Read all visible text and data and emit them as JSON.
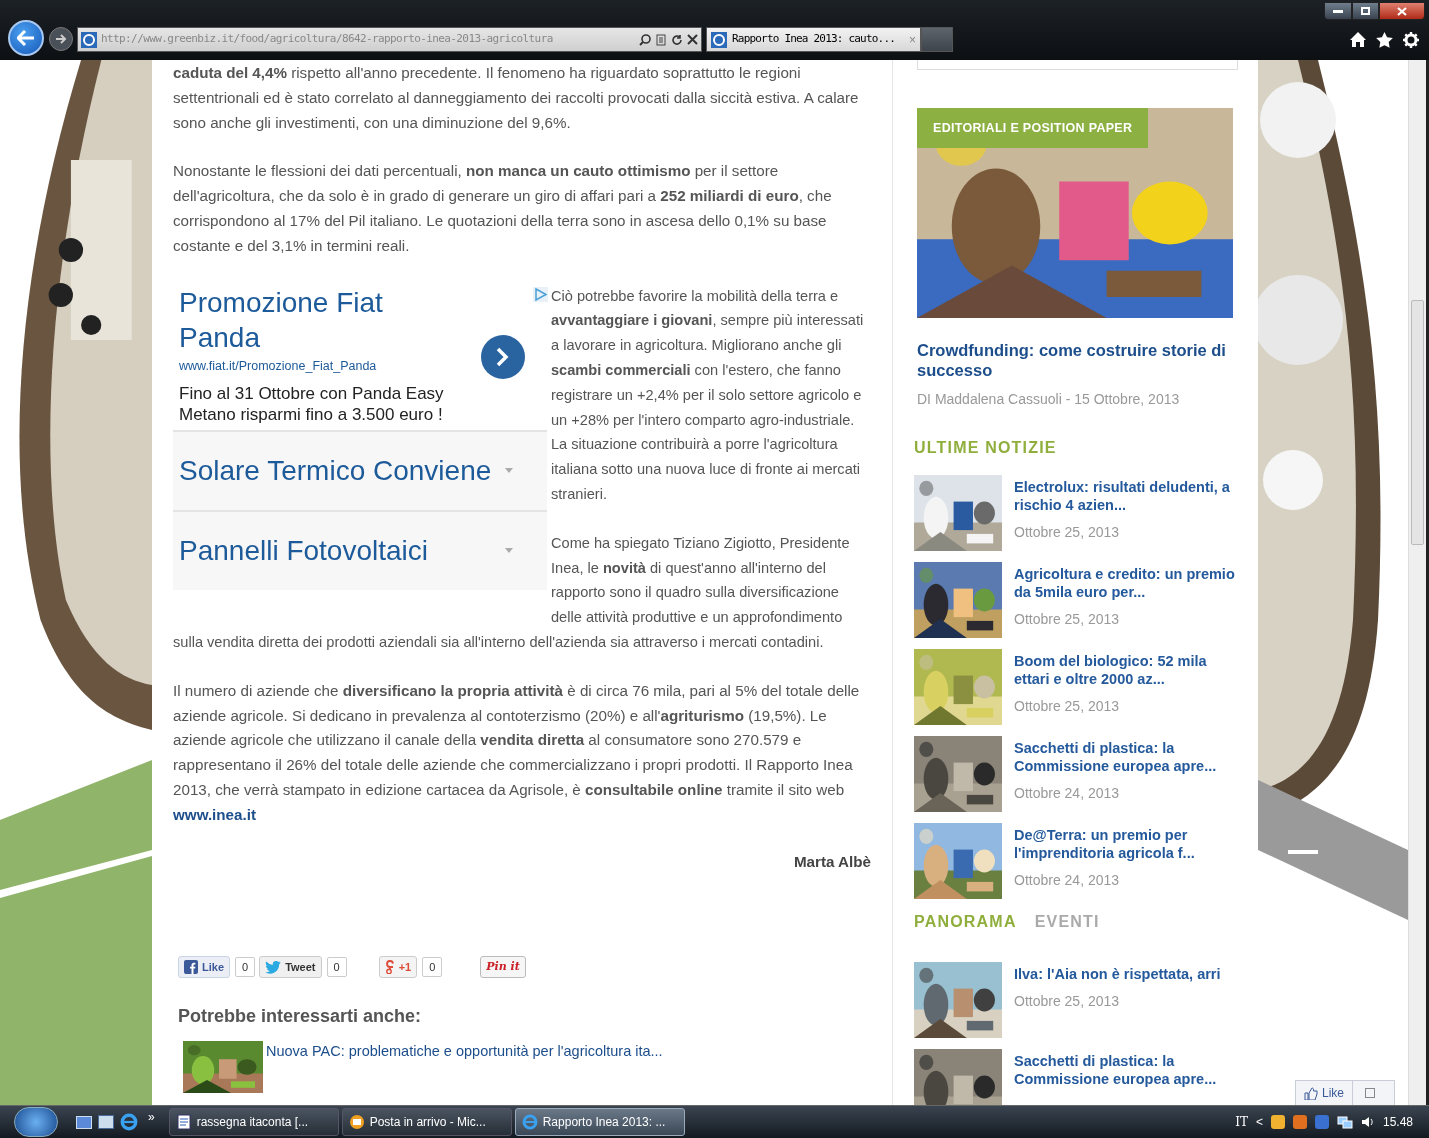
{
  "browser": {
    "url": "http://www.greenbiz.it/food/agricoltura/8642-rapporto-inea-2013-agricoltura",
    "tabs": [
      {
        "title": "Rapporto Inea 2013: cauto...",
        "close": "×",
        "selected": true
      }
    ]
  },
  "article": {
    "paragraphs_top": [
      "**caduta del 4,4%** rispetto all'anno precedente. Il fenomeno ha riguardato soprattutto le regioni settentrionali ed è stato correlato al danneggiamento dei raccolti provocati dalla siccità estiva. A calare sono anche gli investimenti, con una diminuzione del 9,6%.",
      "Nonostante le flessioni dei dati percentuali, **non manca un cauto ottimismo** per il settore dell'agricoltura, che da solo è in grado di generare un giro di affari pari a **252 miliardi di euro**, che corrispondono al 17% del Pil italiano. Le quotazioni della terra sono in ascesa dello 0,1% su base costante e del 3,1% in termini reali."
    ],
    "ad": {
      "title": "Promozione Fiat Panda",
      "url": "www.fiat.it/Promozione_Fiat_Panda",
      "text": "Fino al 31 Ottobre con Panda Easy Metano risparmi fino a 3.500 euro !",
      "links": [
        {
          "title": "Solare Termico Conviene",
          "expanded": false
        },
        {
          "title": "Pannelli Fotovoltaici",
          "expanded": false
        }
      ]
    },
    "paragraphs_wrap": [
      "Ciò potrebbe favorire la mobilità della terra e **avvantaggiare i giovani**, sempre  più interessati a lavorare in agricoltura. Migliorano anche gli **scambi commerciali** con l'estero, che fanno registrare un +2,4% per il solo settore agricolo e un +28% per l'intero comparto agro-industriale. La situazione contribuirà a porre l'agricoltura italiana sotto una nuova luce di fronte ai mercati stranieri.",
      "Come ha spiegato Tiziano Zigiotto, Presidente Inea, le **novità** di quest'anno all'interno del rapporto sono il quadro sulla diversificazione delle attività produttive e un approfondimento"
    ],
    "paragraph_continuation": "sulla vendita diretta dei prodotti aziendali sia all'interno dell'azienda sia attraverso i mercati contadini.",
    "last_paragraph": {
      "text": "Il numero di aziende che **diversificano la propria attività** è di circa 76 mila, pari al 5% del totale delle aziende agricole. Si dedicano in prevalenza al contoterzismo (20%) e all'**agriturismo** (19,5%). Le aziende agricole che utilizzano il canale della **vendita diretta** al consumatore sono 270.579 e rappresentano il 26% del totale delle aziende che commercializzano i propri prodotti. Il Rapporto Inea 2013, che verrà stampato in edizione cartacea da Agrisole, è **consultabile online** tramite il sito web",
      "link": "www.inea.it"
    },
    "author": "Marta Albè"
  },
  "social": [
    {
      "kind": "facebook",
      "label": "Like",
      "count": "0"
    },
    {
      "kind": "twitter",
      "label": "Tweet",
      "count": "0"
    },
    {
      "kind": "gplus",
      "label": "+1",
      "count": "0"
    },
    {
      "kind": "pinterest",
      "label": "Pin it"
    }
  ],
  "related": {
    "heading": "Potrebbe interessarti anche:",
    "items": [
      {
        "title": "Nuova PAC: problematiche e opportunità per l'agricoltura ita..."
      }
    ]
  },
  "sidebar": {
    "featured": {
      "badge": "EDITORIALI E POSITION PAPER",
      "title": "Crowdfunding: come costruire storie di successo",
      "byline": "DI Maddalena Cassuoli - 15 Ottobre, 2013"
    },
    "latest": {
      "heading": "ULTIME NOTIZIE",
      "items": [
        {
          "title": "Electrolux: risultati deludenti, a rischio 4 azien...",
          "date": "Ottobre 25, 2013"
        },
        {
          "title": "Agricoltura e credito: un premio da 5mila euro per...",
          "date": "Ottobre 25, 2013"
        },
        {
          "title": "Boom del biologico: 52 mila ettari e oltre 2000 az...",
          "date": "Ottobre 25, 2013"
        },
        {
          "title": "Sacchetti di plastica: la Commissione europea apre...",
          "date": "Ottobre 24, 2013"
        },
        {
          "title": "De@Terra: un premio per l'imprenditoria agricola f...",
          "date": "Ottobre 24, 2013"
        }
      ]
    },
    "tabs": [
      {
        "label": "PANORAMA",
        "selected": true
      },
      {
        "label": "EVENTI",
        "selected": false
      }
    ],
    "panorama": [
      {
        "title": "Ilva: l'Aia non è rispettata, arri",
        "date": "Ottobre 25, 2013"
      },
      {
        "title": "Sacchetti di plastica: la Commissione europea apre..."
      }
    ]
  },
  "fb_widget": {
    "label": "Like"
  },
  "taskbar": {
    "more": "»",
    "items": [
      {
        "label": "rassegna itaconta [...",
        "kind": "doc",
        "selected": false
      },
      {
        "label": "Posta in arrivo - Mic...",
        "kind": "mail",
        "selected": false
      },
      {
        "label": "Rapporto Inea 2013: ...",
        "kind": "ie",
        "selected": true
      }
    ],
    "language": "IT",
    "tray_toggle": "<",
    "clock": "15.48"
  }
}
